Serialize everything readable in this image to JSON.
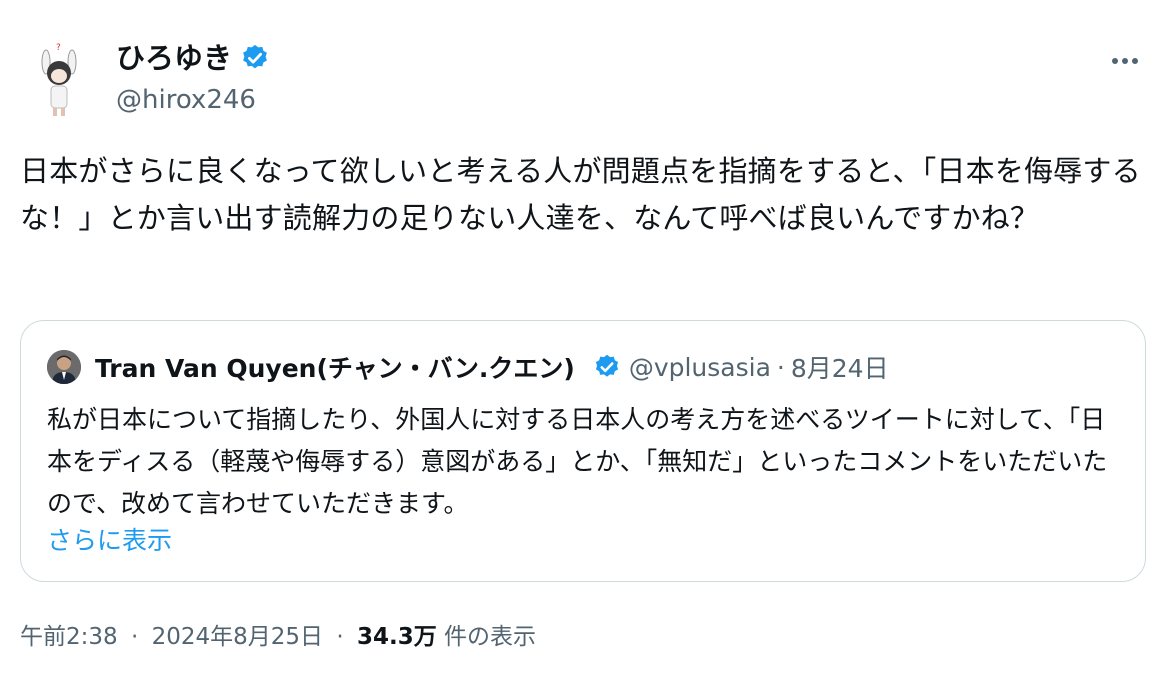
{
  "author": {
    "display_name": "ひろゆき",
    "handle": "@hirox246"
  },
  "tweet": {
    "text": "日本がさらに良くなって欲しいと考える人が問題点を指摘をすると、「日本を侮辱するな！」とか言い出す読解力の足りない人達を、なんて呼べば良いんですかね？"
  },
  "quoted": {
    "display_name": "Tran Van Quyen(チャン・バン.クエン)",
    "handle": "@vplusasia",
    "separator": "·",
    "date": "8月24日",
    "text": "私が日本について指摘したり、外国人に対する日本人の考え方を述べるツイートに対して、「日本をディスる（軽蔑や侮辱する）意図がある」とか、「無知だ」といったコメントをいただいたので、改めて言わせていただきます。",
    "show_more": "さらに表示"
  },
  "footer": {
    "time": "午前2:38",
    "separator": "·",
    "date": "2024年8月25日",
    "separator2": "·",
    "views": "34.3万",
    "views_label": "件の表示"
  },
  "colors": {
    "accent": "#1d9bf0",
    "secondary_text": "#536471",
    "border": "#cfd9de"
  },
  "icons": [
    "avatar-illustration",
    "verified-badge-icon",
    "more-options-icon"
  ]
}
